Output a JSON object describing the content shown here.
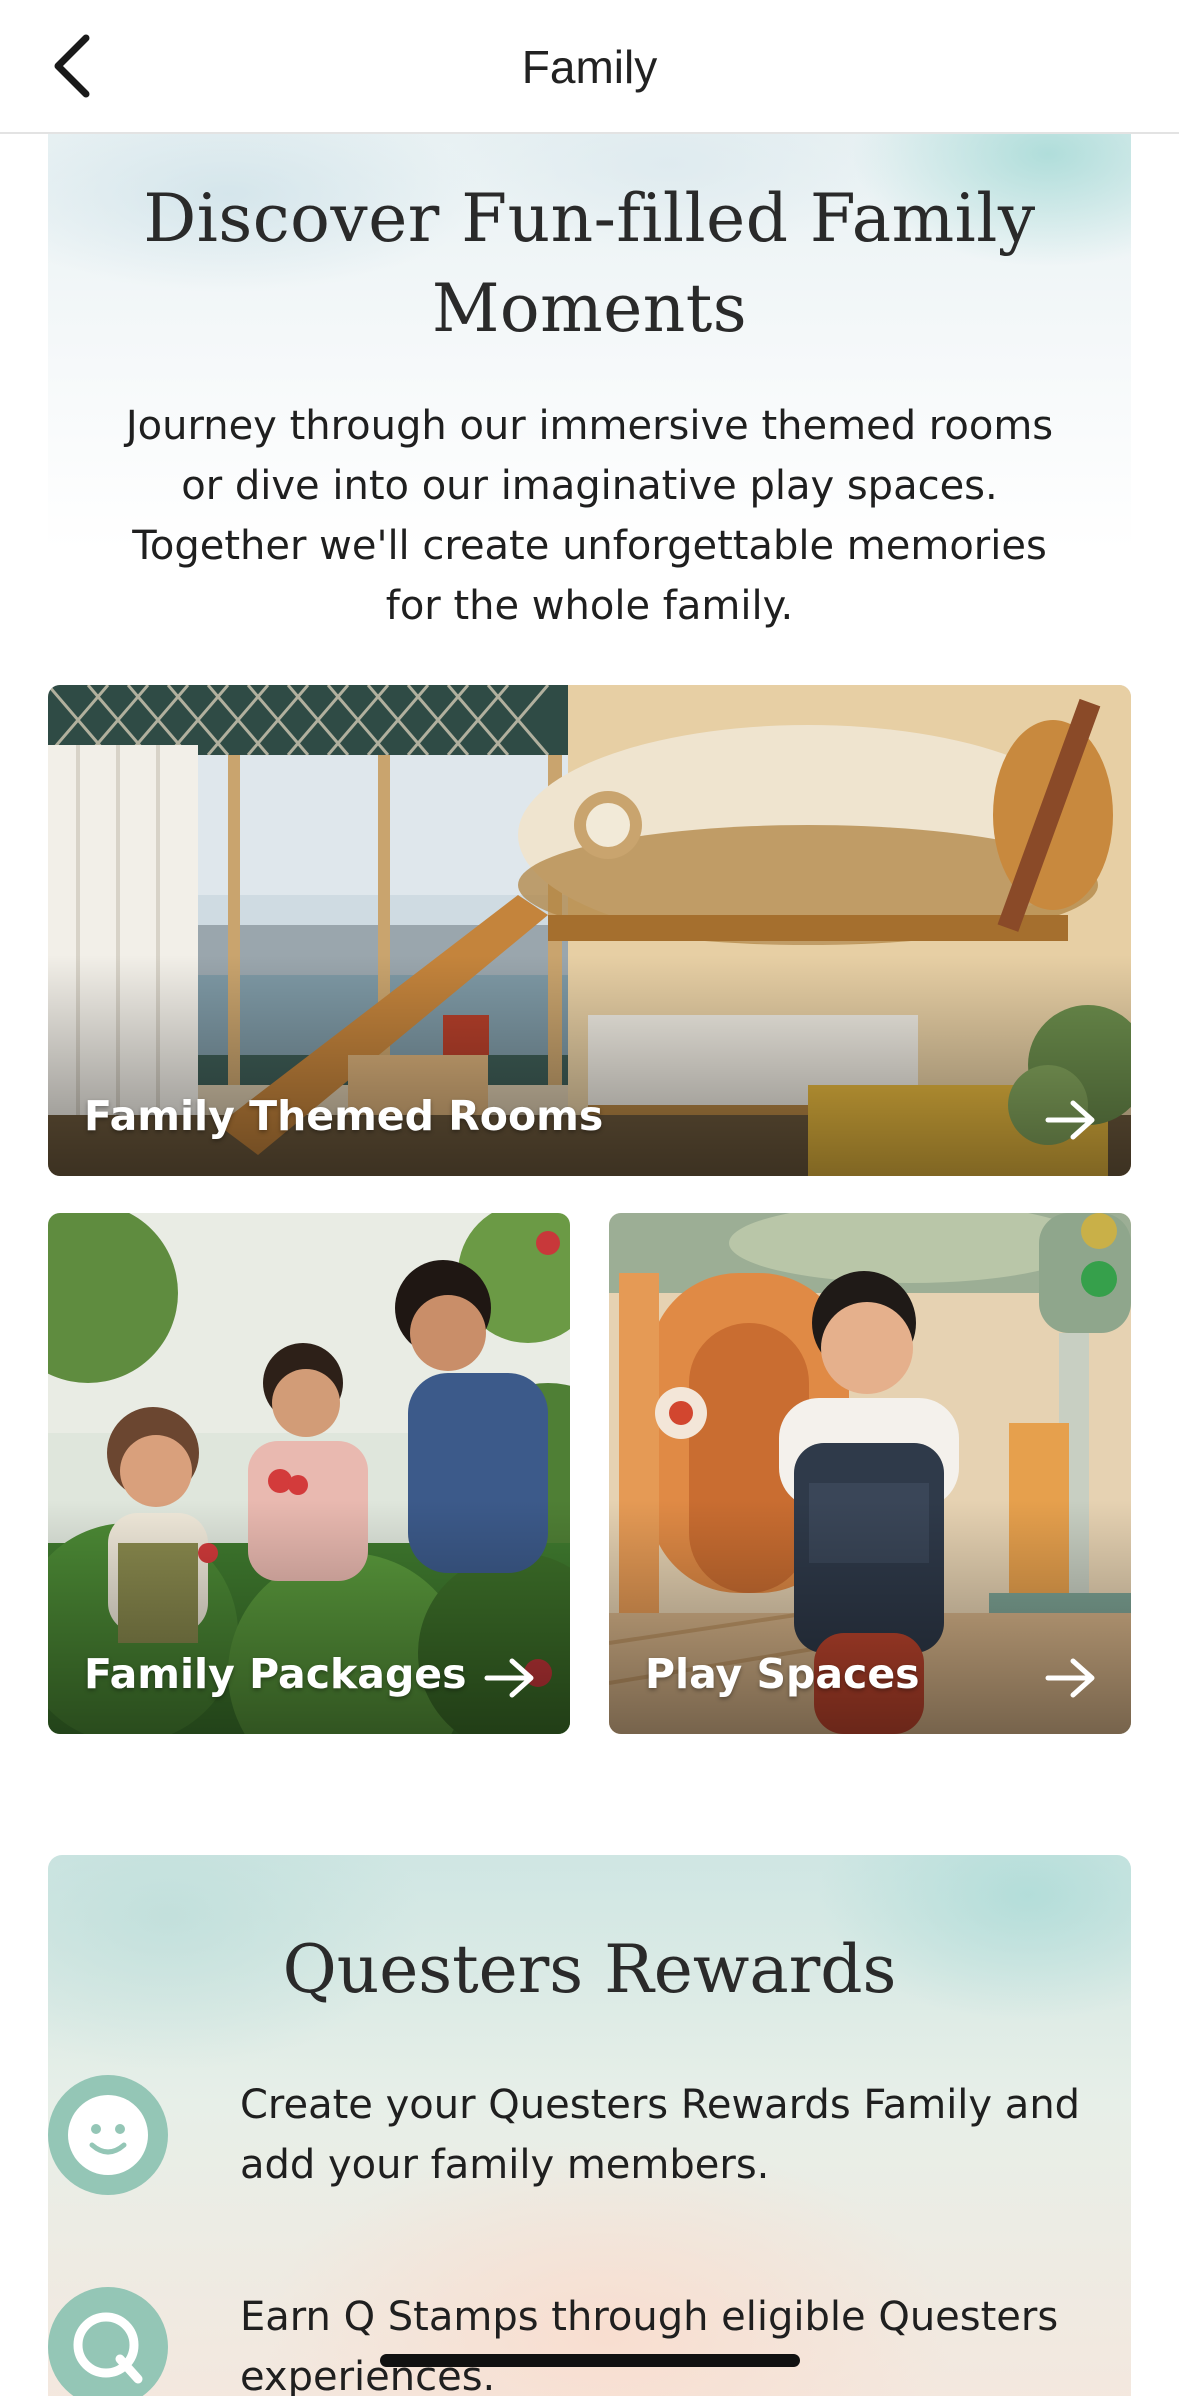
{
  "navbar": {
    "title": "Family",
    "back_icon": "chevron-left-icon"
  },
  "intro": {
    "title": "Discover Fun-filled Family Moments",
    "body": "Journey through our immersive themed rooms or dive into our imaginative play spaces. Together we'll create unforgettable memories for the whole family."
  },
  "cards": [
    {
      "label": "Family Themed Rooms",
      "icon": "arrow-right-icon"
    },
    {
      "label": "Family Packages",
      "icon": "arrow-right-icon"
    },
    {
      "label": "Play Spaces",
      "icon": "arrow-right-icon"
    }
  ],
  "rewards": {
    "title": "Questers Rewards",
    "items": [
      {
        "icon": "smiley-face-icon",
        "text": "Create your Questers Rewards Family and add your family members."
      },
      {
        "icon": "q-logo-icon",
        "text": "Earn Q Stamps through eligible Questers experiences."
      }
    ]
  },
  "colors": {
    "icon_circle": "#94c6b6",
    "text_dark": "#1f1f1f"
  }
}
